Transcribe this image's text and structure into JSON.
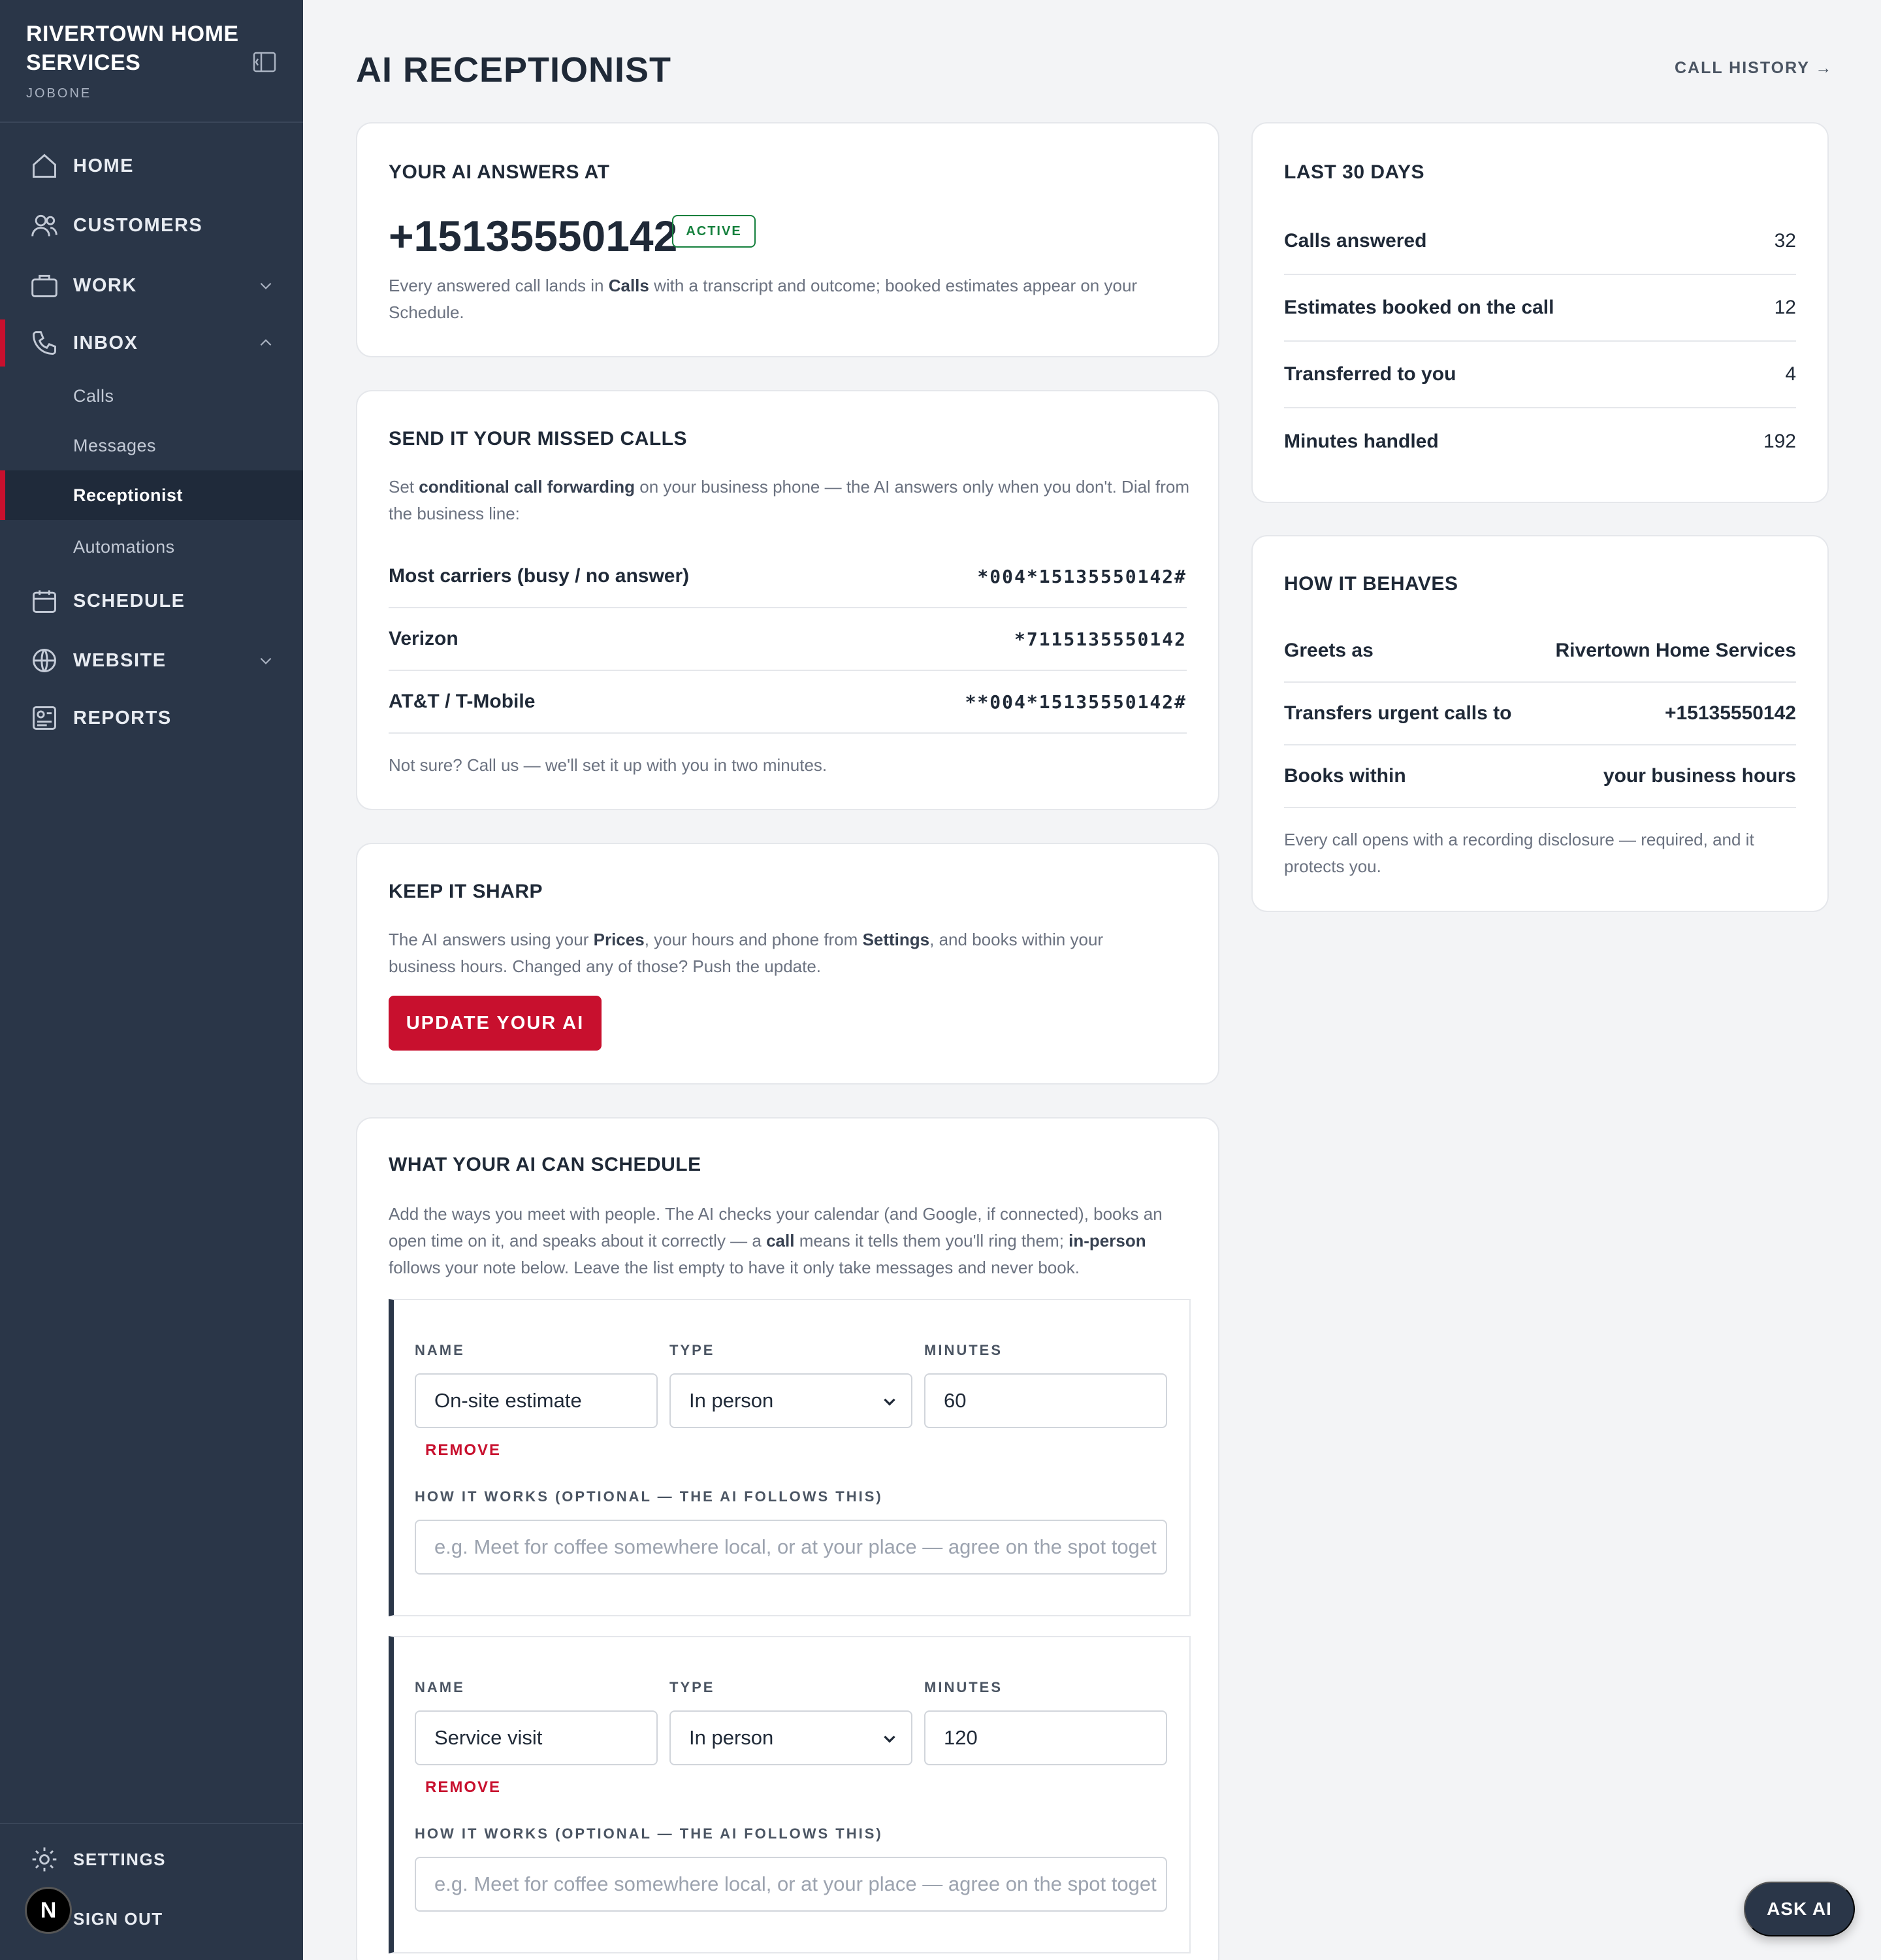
{
  "sidebar": {
    "brand": "RIVERTOWN HOME SERVICES",
    "sub": "JOBONE",
    "nav": {
      "home": "HOME",
      "customers": "CUSTOMERS",
      "work": "WORK",
      "inbox": "INBOX",
      "schedule": "SCHEDULE",
      "website": "WEBSITE",
      "reports": "REPORTS"
    },
    "inbox_items": [
      "Calls",
      "Messages",
      "Receptionist",
      "Automations"
    ],
    "settings": "SETTINGS",
    "sign_out": "SIGN OUT",
    "avatar": "N"
  },
  "header": {
    "title": "AI RECEPTIONIST",
    "call_history": "CALL HISTORY →"
  },
  "answers_card": {
    "title": "YOUR AI ANSWERS AT",
    "phone": "+15135550142",
    "badge": "ACTIVE",
    "desc_1": "Every answered call lands in ",
    "desc_bold": "Calls",
    "desc_2": " with a transcript and outcome; booked estimates appear on your Schedule."
  },
  "missed_card": {
    "title": "SEND IT YOUR MISSED CALLS",
    "desc_1": "Set ",
    "desc_bold": "conditional call forwarding",
    "desc_2": " on your business phone — the AI answers only when you don't. Dial from the business line:",
    "rows": [
      {
        "label": "Most carriers (busy / no answer)",
        "code": "*004*15135550142#"
      },
      {
        "label": "Verizon",
        "code": "*7115135550142"
      },
      {
        "label": "AT&T / T-Mobile",
        "code": "**004*15135550142#"
      }
    ],
    "footer": "Not sure? Call us — we'll set it up with you in two minutes."
  },
  "sharp_card": {
    "title": "KEEP IT SHARP",
    "desc_1": "The AI answers using your ",
    "desc_b1": "Prices",
    "desc_2": ", your hours and phone from ",
    "desc_b2": "Settings",
    "desc_3": ", and books within your business hours. Changed any of those? Push the update.",
    "button": "UPDATE YOUR AI"
  },
  "schedule_card": {
    "title": "WHAT YOUR AI CAN SCHEDULE",
    "desc_1": "Add the ways you meet with people. The AI checks your calendar (and Google, if connected), books an open time on it, and speaks about it correctly — a ",
    "desc_b1": "call",
    "desc_2": " means it tells them you'll ring them; ",
    "desc_b2": "in-person",
    "desc_3": " follows your note below. Leave the list empty to have it only take messages and never book.",
    "labels": {
      "name": "NAME",
      "type": "TYPE",
      "minutes": "MINUTES",
      "how": "HOW IT WORKS (OPTIONAL — THE AI FOLLOWS THIS)",
      "remove": "REMOVE"
    },
    "services": [
      {
        "name": "On-site estimate",
        "type": "In person",
        "minutes": "60",
        "placeholder": "e.g. Meet for coffee somewhere local, or at your place — agree on the spot toget"
      },
      {
        "name": "Service visit",
        "type": "In person",
        "minutes": "120",
        "placeholder": "e.g. Meet for coffee somewhere local, or at your place — agree on the spot toget"
      }
    ]
  },
  "stats_card": {
    "title": "LAST 30 DAYS",
    "rows": [
      {
        "label": "Calls answered",
        "value": "32"
      },
      {
        "label": "Estimates booked on the call",
        "value": "12"
      },
      {
        "label": "Transferred to you",
        "value": "4"
      },
      {
        "label": "Minutes handled",
        "value": "192"
      }
    ]
  },
  "behaves_card": {
    "title": "HOW IT BEHAVES",
    "rows": [
      {
        "label": "Greets as",
        "value": "Rivertown Home Services"
      },
      {
        "label": "Transfers urgent calls to",
        "value": "+15135550142"
      },
      {
        "label": "Books within",
        "value": "your business hours"
      }
    ],
    "footer": "Every call opens with a recording disclosure — required, and it protects you."
  },
  "ask_ai": "ASK AI",
  "colors": {
    "accent": "#c8102e",
    "sidebar": "#2a3648",
    "active": "#15803d"
  }
}
